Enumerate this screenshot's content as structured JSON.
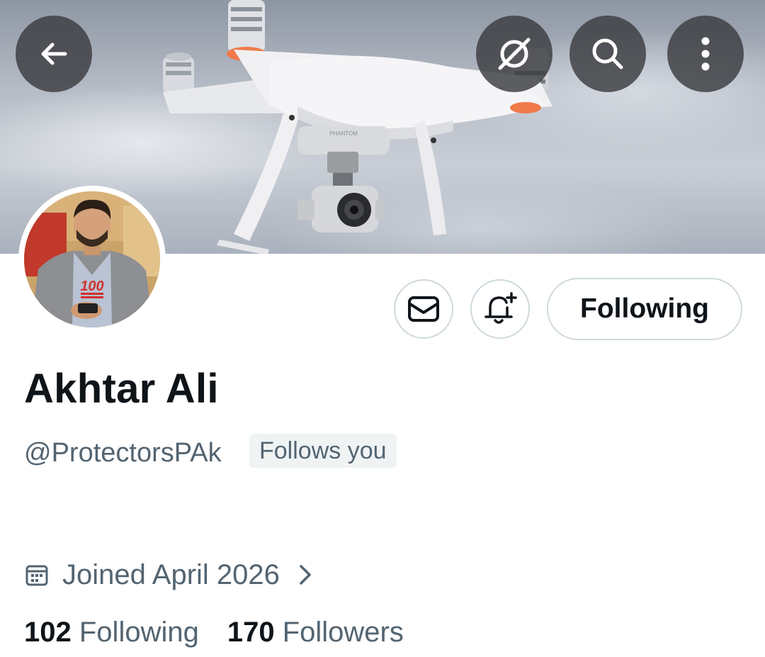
{
  "profile": {
    "display_name": "Akhtar Ali",
    "handle": "@ProtectorsPAk",
    "follows_you_badge": "Follows you",
    "joined": "Joined April 2026",
    "following_count": "102",
    "following_label": "Following",
    "followers_count": "170",
    "followers_label": "Followers"
  },
  "actions": {
    "follow_state_label": "Following"
  },
  "banner": {
    "drone_brand_text": "PHANTOM"
  },
  "avatar": {
    "shirt_emoji_text": "100"
  },
  "icons": {
    "back": "arrow-left-icon",
    "grok": "slash-circle-icon",
    "search": "search-icon",
    "more": "more-vertical-icon",
    "message": "envelope-icon",
    "notify": "bell-plus-icon",
    "calendar": "calendar-icon",
    "chevron": "chevron-right-icon"
  },
  "colors": {
    "text_primary": "#0f1419",
    "text_secondary": "#536471",
    "border": "#cfd9de",
    "badge_bg": "#eff3f4",
    "overlay_button_bg": "#3a3c40"
  }
}
